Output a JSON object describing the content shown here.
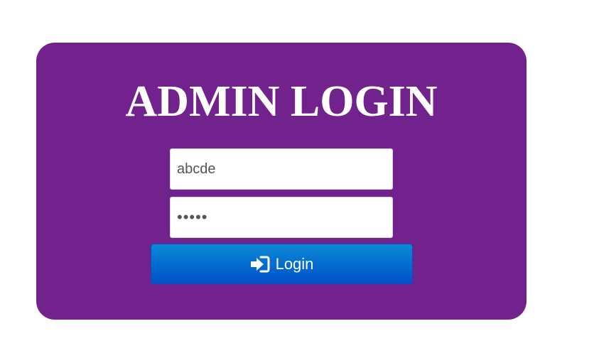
{
  "login": {
    "title": "ADMIN LOGIN",
    "username_value": "abcde",
    "password_value": "abcde",
    "button_label": "Login",
    "button_icon": "sign-in-icon"
  },
  "colors": {
    "card_background": "#72228c",
    "button_gradient_top": "#0a8ad6",
    "button_gradient_bottom": "#0050c8",
    "title_text": "#ffffff"
  }
}
